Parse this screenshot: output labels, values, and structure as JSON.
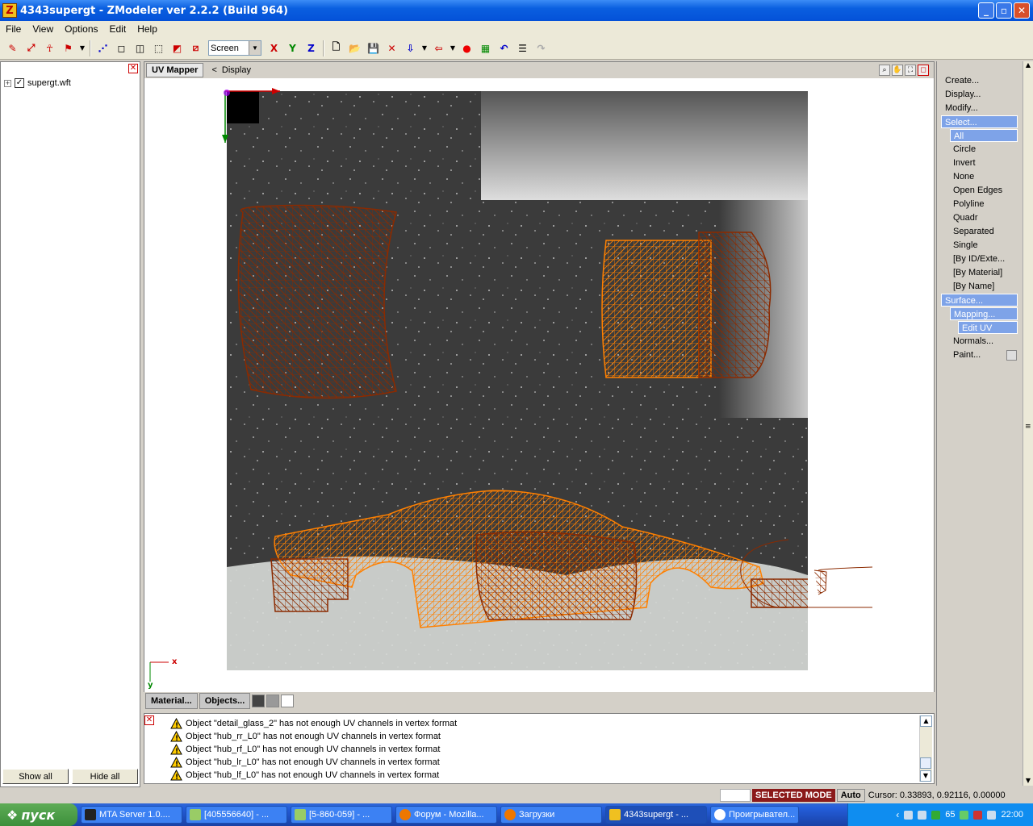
{
  "window": {
    "title": "4343supergt - ZModeler ver 2.2.2 (Build 964)",
    "logo_letter": "Z"
  },
  "menu": [
    "File",
    "View",
    "Options",
    "Edit",
    "Help"
  ],
  "toolbar": {
    "view_select": "Screen",
    "axis_x": "X",
    "axis_y": "Y",
    "axis_z": "Z"
  },
  "left_panel": {
    "tree_item": "supergt.wft",
    "show_all": "Show all",
    "hide_all": "Hide all"
  },
  "viewport": {
    "tab": "UV Mapper",
    "crumb_arrow": "<",
    "crumb": "Display",
    "axis_x_label": "x",
    "axis_y_label": "y"
  },
  "bottom_tabs": {
    "material": "Material...",
    "objects": "Objects..."
  },
  "log": [
    "Object \"detail_glass_2\" has not enough UV channels in vertex format",
    "Object \"hub_rr_L0\" has not enough UV channels in vertex format",
    "Object \"hub_rf_L0\" has not enough UV channels in vertex format",
    "Object \"hub_lr_L0\" has not enough UV channels in vertex format",
    "Object \"hub_lf_L0\" has not enough UV channels in vertex format"
  ],
  "right_panel": {
    "create": "Create...",
    "display": "Display...",
    "modify": "Modify...",
    "select": "Select...",
    "select_items": [
      "All",
      "Circle",
      "Invert",
      "None",
      "Open Edges",
      "Polyline",
      "Quadr",
      "Separated",
      "Single",
      "[By ID/Exte...",
      "[By Material]",
      "[By Name]"
    ],
    "surface": "Surface...",
    "mapping": "Mapping...",
    "edit_uv": "Edit UV",
    "normals": "Normals...",
    "paint": "Paint..."
  },
  "status": {
    "mode": "SELECTED MODE",
    "auto": "Auto",
    "cursor": "Cursor: 0.33893, 0.92116, 0.00000"
  },
  "taskbar": {
    "start": "пуск",
    "tasks": [
      "MTA Server 1.0....",
      "[405556640] - ...",
      "[5-860-059] - ...",
      "Форум - Mozilla...",
      "Загрузки",
      "4343supergt - ...",
      "Проигрывател..."
    ],
    "clock": "22:00",
    "tray_num": "65"
  },
  "colors": {
    "wire_dark": "#8b2a00",
    "wire_light": "#ff8000",
    "selected_mode": "#8b1a1a"
  }
}
